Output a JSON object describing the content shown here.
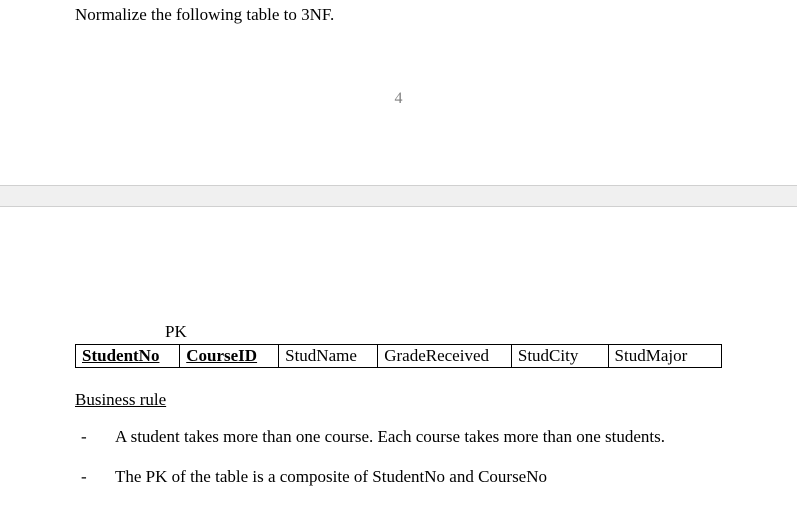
{
  "top": {
    "instruction": "Normalize the following table to 3NF.",
    "page_number": "4"
  },
  "bottom": {
    "pk_label": "PK",
    "columns": {
      "c1": "StudentNo",
      "c2": "CourseID",
      "c3": "StudName",
      "c4": "GradeReceived",
      "c5": "StudCity",
      "c6": "StudMajor"
    },
    "section_heading": "Business rule",
    "rules": {
      "r1": "A student takes more than one course. Each course takes more than one students.",
      "r2": "The PK of the table is a composite of StudentNo and CourseNo"
    }
  }
}
